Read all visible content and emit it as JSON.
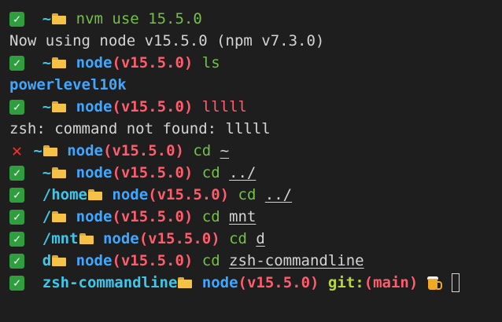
{
  "tilde": "~",
  "node_label": "node",
  "node_version": "(v15.5.0)",
  "git_label": "git:",
  "branch": "(main)",
  "lines": [
    {
      "command": "nvm use 15.5.0"
    },
    {
      "output": "Now using node v15.5.0 (npm v7.3.0)"
    },
    {
      "command": "ls"
    },
    {
      "output": "powerlevel10k"
    },
    {
      "command": "lllll"
    },
    {
      "output": "zsh: command not found: lllll"
    },
    {
      "command": "cd",
      "arg": "~"
    },
    {
      "command": "cd",
      "arg": "../"
    },
    {
      "dir": "/home",
      "command": "cd",
      "arg": "../"
    },
    {
      "dir": "/",
      "command": "cd",
      "arg": "mnt"
    },
    {
      "dir": "/mnt",
      "command": "cd",
      "arg": "d"
    },
    {
      "dir": "d",
      "command": "cd",
      "arg": "zsh-commandline"
    },
    {
      "dir": "zsh-commandline"
    }
  ],
  "icons": {
    "success": "check-mark-button-icon",
    "failure": "cross-mark-icon",
    "folder": "open-folder-icon",
    "beer": "beer-mugs-icon"
  },
  "colors": {
    "background": "#1e1e1e",
    "success_bg": "#2e9e3e",
    "failure": "#e8342f",
    "directory": "#3fc7ea",
    "node": "#3fa7ff",
    "version": "#ff5c6c",
    "command": "#72c048",
    "git": "#b7d63e"
  }
}
